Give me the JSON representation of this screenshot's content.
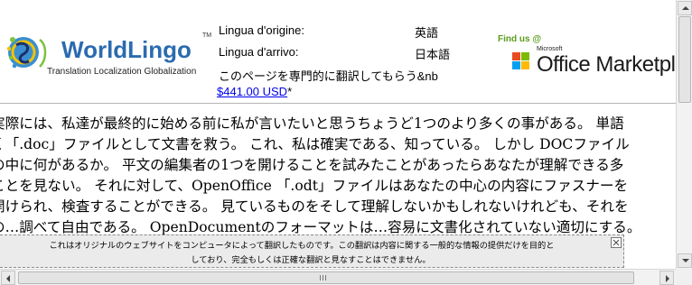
{
  "logo": {
    "name": "WorldLingo",
    "tm": "TM",
    "tagline": "Translation Localization Globalization"
  },
  "translation_info": {
    "origin_label": "Lingua d'origine:",
    "origin_value": "英語",
    "target_label": "Lingua d'arrivo:",
    "target_value": "日本語",
    "pro_text": "このページを専門的に翻訳してもらう&nb",
    "price": "$441.00 USD",
    "price_suffix": "*"
  },
  "marketplace": {
    "find_us": "Find us @",
    "microsoft": "Microsoft",
    "label": "Office Marketplace"
  },
  "content": {
    "lines": [
      "実際には、私達が最終的に始める前に私が言いたいと思うちょうど1つのより多くの事がある。 単語",
      "く「.doc」ファイルとして文書を救う。 これ、私は確実である、知っている。 しかし DOCファイル",
      "の中に何があるか。 平文の編集者の1つを開けることを試みたことがあったらあなたが理解できる多",
      "ことを見ない。 それに対して、OpenOffice 「.odt」ファイルはあなたの中心の内容にファスナーを",
      "開けられ、検査することができる。 見ているものをそして理解しないかもしれないけれども、それを",
      "の…調べて自由である。 OpenDocumentのフォーマットは…容易に文書化されていない適切にする。"
    ]
  },
  "disclaimer": {
    "line1": "これはオリジナルのウェブサイトをコンピュータによって翻訳したものです。この翻訳は内容に関する一般的な情報の提供だけを目的と",
    "line2": "しており、完全もしくは正確な翻訳と見なすことはできません。"
  },
  "colors": {
    "brand_blue": "#2b6bb0",
    "find_us_green": "#5a9b1c",
    "link": "#0000ee",
    "disclaimer_bg": "#ebebeb"
  }
}
